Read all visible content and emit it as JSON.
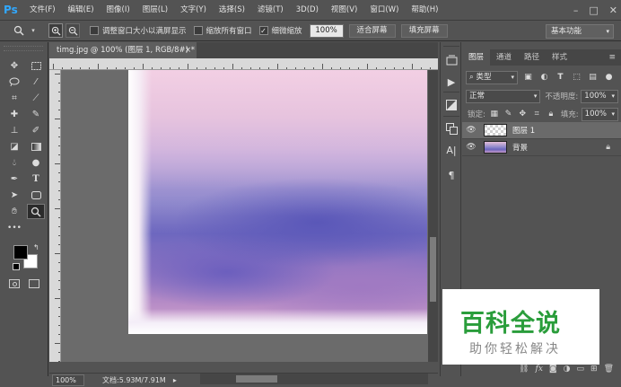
{
  "app": {
    "logo": "Ps"
  },
  "menu": [
    "文件(F)",
    "编辑(E)",
    "图像(I)",
    "图层(L)",
    "文字(Y)",
    "选择(S)",
    "滤镜(T)",
    "3D(D)",
    "视图(V)",
    "窗口(W)",
    "帮助(H)"
  ],
  "window_controls": {
    "minimize": "–",
    "restore": "□",
    "close": "✕"
  },
  "options": {
    "checkbox_resize": "调整窗口大小以满屏显示",
    "checkbox_all_windows": "缩放所有窗口",
    "checkbox_scrubby": "细微缩放",
    "zoom_value": "100%",
    "fit_screen": "适合屏幕",
    "fill_screen": "填充屏幕",
    "workspace": "基本功能"
  },
  "document": {
    "tab_title": "timg.jpg @ 100% (图层 1, RGB/8#) *",
    "close": "×"
  },
  "status": {
    "zoom": "100%",
    "doc_info": "文档:5.93M/7.91M",
    "arrow": "▸"
  },
  "layers_panel": {
    "tabs": [
      "图层",
      "通道",
      "路径",
      "样式"
    ],
    "filter_kind": "类型",
    "blend_mode": "正常",
    "opacity_label": "不透明度:",
    "opacity_value": "100%",
    "lock_label": "锁定:",
    "fill_label": "填充:",
    "fill_value": "100%",
    "layers": [
      {
        "name": "图层 1",
        "selected": true,
        "locked": false
      },
      {
        "name": "背景",
        "selected": false,
        "locked": true
      }
    ],
    "footer_icons": [
      "link-icon",
      "fx-icon",
      "mask-icon",
      "adjustment-icon",
      "group-icon",
      "new-layer-icon",
      "trash-icon"
    ]
  },
  "watermark": {
    "title": "百科全说",
    "subtitle": "助你轻松解决"
  },
  "colors": {
    "ui_bg": "#535353",
    "ps_blue": "#31a8ff",
    "watermark_green": "#2a9d3b"
  }
}
